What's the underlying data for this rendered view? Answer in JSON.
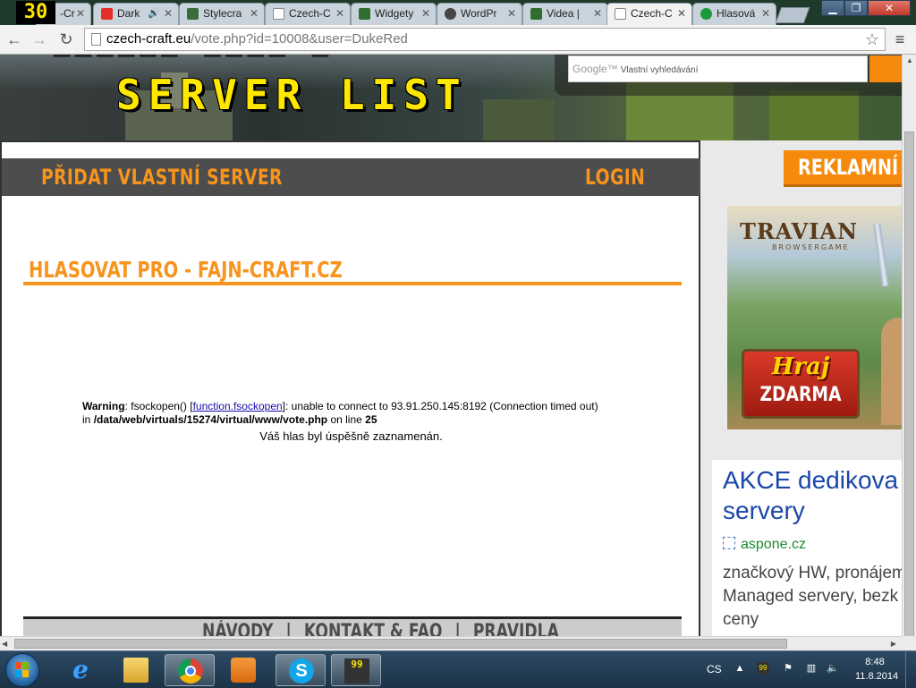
{
  "overlay": {
    "fps": "30"
  },
  "tabs": [
    {
      "title": "-Cr",
      "icon": "page-icon",
      "color": "#9aa7b3"
    },
    {
      "title": "Dark",
      "icon": "youtube-icon",
      "color": "#e52d27",
      "audio": "speaker-icon"
    },
    {
      "title": "Stylecra",
      "icon": "stylecraft-icon",
      "color": "#3b6b3b"
    },
    {
      "title": "Czech-C",
      "icon": "page-icon",
      "color": "#ffffff"
    },
    {
      "title": "Widgety",
      "icon": "wp-widget-icon",
      "color": "#2f6e2f"
    },
    {
      "title": "WordPr",
      "icon": "wordpress-icon",
      "color": "#464646"
    },
    {
      "title": "Videa | ",
      "icon": "wp-widget-icon",
      "color": "#2f6e2f"
    },
    {
      "title": "Czech-C",
      "icon": "page-icon",
      "color": "#ffffff",
      "active": true
    },
    {
      "title": "Hlasová",
      "icon": "green-shield-icon",
      "color": "#1a9a3a"
    }
  ],
  "toolbar": {
    "url_host": "czech-craft.eu",
    "url_path": "/vote.php?id=10008&user=DukeRed",
    "star": "☆",
    "menu": "≡"
  },
  "banner": {
    "title": "SERVER LIST",
    "search_placeholder": "Vlastní vyhledávání",
    "search_brand": "Google™"
  },
  "nav": {
    "add_server": "PŘIDAT VLASTNÍ SERVER",
    "login": "LOGIN"
  },
  "main": {
    "vote_title": "HLASOVAT PRO - FAJN-CRAFT.CZ",
    "warning": {
      "label": "Warning",
      "text1": ": fsockopen() [",
      "link": "function.fsockopen",
      "text2": "]: unable to connect to 93.91.250.145:8192 (Connection timed out)",
      "in": "in ",
      "path": "/data/web/virtuals/15274/virtual/www/vote.php",
      "online": " on line ",
      "line": "25"
    },
    "success": "Váš hlas byl úspěšně zaznamenán.",
    "footer_links": [
      "NÁVODY",
      "|",
      "KONTAKT & FAQ",
      "|",
      "PRAVIDLA"
    ]
  },
  "sidebar": {
    "ad_title": "REKLAMNÍ P",
    "travian": {
      "logo": "TRAVIAN",
      "sub": "BROWSERGAME",
      "button_top": "Hraj",
      "button_bottom": "ZDARMA"
    },
    "akce": {
      "title_line1": "AKCE dedikova",
      "title_line2": "servery",
      "host": "aspone.cz",
      "desc_line1": "značkový HW, pronájem",
      "desc_line2": "Managed servery, bezk",
      "desc_line3": "ceny"
    }
  },
  "taskbar": {
    "apps": [
      "internet-explorer",
      "windows-explorer",
      "google-chrome",
      "media-player",
      "skype",
      "fraps"
    ],
    "fraps_label": "99",
    "language": "CS",
    "time": "8:48",
    "date": "11.8.2014"
  }
}
